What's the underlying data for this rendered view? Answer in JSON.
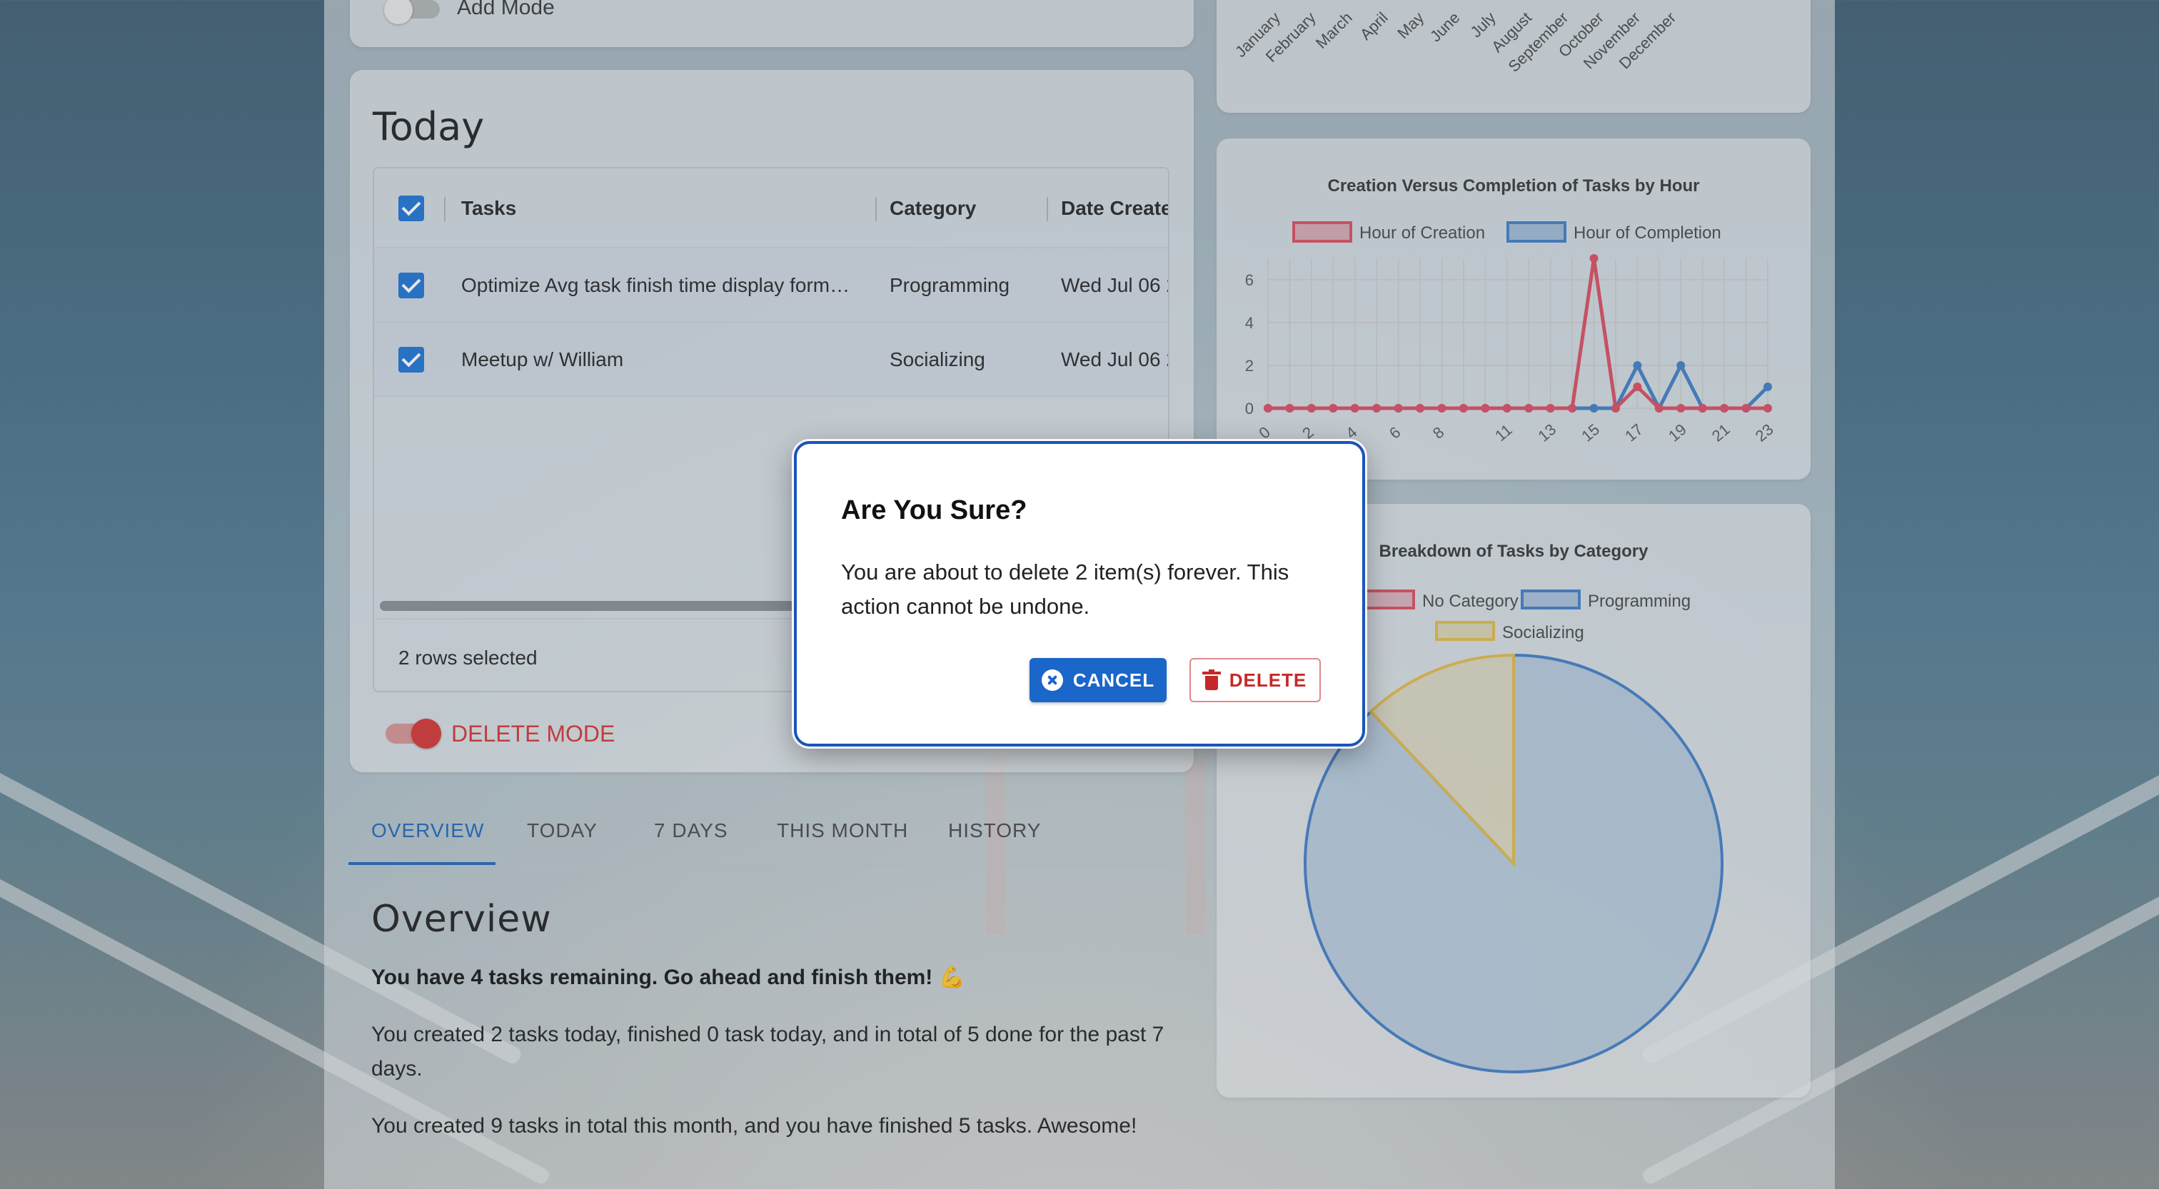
{
  "add_mode": {
    "label": "Add Mode",
    "enabled": false
  },
  "today": {
    "title": "Today",
    "columns": {
      "tasks": "Tasks",
      "category": "Category",
      "date_created": "Date Create"
    },
    "rows": [
      {
        "task": "Optimize Avg task finish time display form…",
        "category": "Programming",
        "date": "Wed Jul 06 2",
        "selected": true
      },
      {
        "task": "Meetup w/ William",
        "category": "Socializing",
        "date": "Wed Jul 06 2",
        "selected": true
      }
    ],
    "rows_selected": "2 rows selected",
    "delete_mode_label": "DELETE MODE",
    "delete_mode_enabled": true
  },
  "tabs": [
    "OVERVIEW",
    "TODAY",
    "7 DAYS",
    "THIS MONTH",
    "HISTORY"
  ],
  "active_tab": "OVERVIEW",
  "overview": {
    "title": "Overview",
    "remaining": "You have 4 tasks remaining. Go ahead and finish them! 💪",
    "weekly": "You created 2 tasks today, finished 0 task today, and in total of 5 done for the past 7 days.",
    "monthly": "You created 9 tasks in total this month, and you have finished 5 tasks. Awesome!"
  },
  "colors": {
    "accent": "#1a62b8",
    "danger": "#d32f2f",
    "series_red": "#d9485f",
    "series_blue": "#3d7bc4",
    "series_yellow": "#e0b84a"
  },
  "chart_data": [
    {
      "type": "bar",
      "title": "",
      "categories": [
        "January",
        "February",
        "March",
        "April",
        "May",
        "June",
        "July",
        "August",
        "September",
        "October",
        "November",
        "December"
      ]
    },
    {
      "type": "line",
      "title": "Creation Versus Completion of Tasks by Hour",
      "x": [
        0,
        1,
        2,
        3,
        4,
        5,
        6,
        7,
        8,
        9,
        10,
        11,
        12,
        13,
        14,
        15,
        16,
        17,
        18,
        19,
        20,
        21,
        22,
        23
      ],
      "x_tick_labels": [
        "0",
        "2",
        "4",
        "6",
        "8",
        "11",
        "13",
        "15",
        "17",
        "19",
        "21",
        "23"
      ],
      "ylim": [
        0,
        7
      ],
      "y_ticks": [
        "0",
        "2",
        "4",
        "6"
      ],
      "grid": true,
      "legend": "top",
      "series": [
        {
          "name": "Hour of Creation",
          "values": [
            0,
            0,
            0,
            0,
            0,
            0,
            0,
            0,
            0,
            0,
            0,
            0,
            0,
            0,
            0,
            7,
            0,
            1,
            0,
            0,
            0,
            0,
            0,
            0
          ]
        },
        {
          "name": "Hour of Completion",
          "values": [
            0,
            0,
            0,
            0,
            0,
            0,
            0,
            0,
            0,
            0,
            0,
            0,
            0,
            0,
            0,
            0,
            0,
            2,
            0,
            2,
            0,
            0,
            0,
            1
          ]
        }
      ]
    },
    {
      "type": "pie",
      "title": "Breakdown of Tasks by Category",
      "legend": "top",
      "labels": [
        "No Category",
        "Programming",
        "Socializing"
      ],
      "values": [
        0,
        88,
        12
      ]
    }
  ],
  "dialog": {
    "title": "Are You Sure?",
    "message": "You are about to delete 2 item(s) forever. This action cannot be undone.",
    "cancel_label": "CANCEL",
    "delete_label": "DELETE"
  }
}
